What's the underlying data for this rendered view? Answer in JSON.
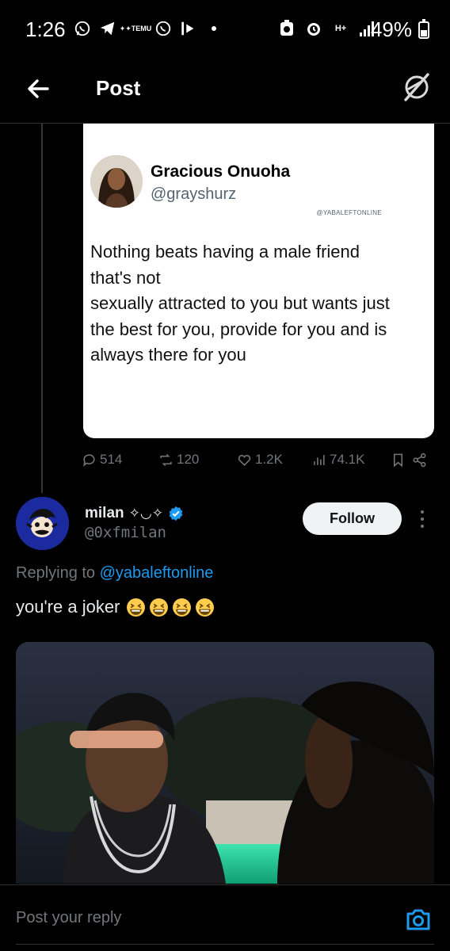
{
  "status_bar": {
    "time": "1:26",
    "temu_label": "TEMU",
    "battery_percent": "49%",
    "network": "H+"
  },
  "header": {
    "title": "Post"
  },
  "quoted_image": {
    "author_name": "Gracious Onuoha",
    "author_handle": "@grayshurz",
    "watermark": "@YABALEFTONLINE",
    "text": "Nothing beats having a male friend that's not sexually attracted to you but wants just the best for you, provide for you and is always there for you",
    "text_lines": [
      "Nothing beats having a male friend",
      "that's not",
      "sexually attracted to you but wants just",
      "the best for you, provide for you and is",
      "always there for you"
    ]
  },
  "actions": {
    "replies": "514",
    "reposts": "120",
    "likes": "1.2K",
    "views": "74.1K"
  },
  "reply": {
    "name": "milan",
    "name_decoration": "✧◡✧",
    "handle": "@0xfmilan",
    "follow_label": "Follow",
    "replying_prefix": "Replying to",
    "replying_handle": "@yabaleftonline",
    "text": "you're a joker",
    "emoji_count": 4
  },
  "composer": {
    "placeholder": "Post your reply"
  },
  "colors": {
    "accent": "#1d9bf0",
    "background": "#000000",
    "muted": "#71767b",
    "divider": "#2f3336"
  }
}
